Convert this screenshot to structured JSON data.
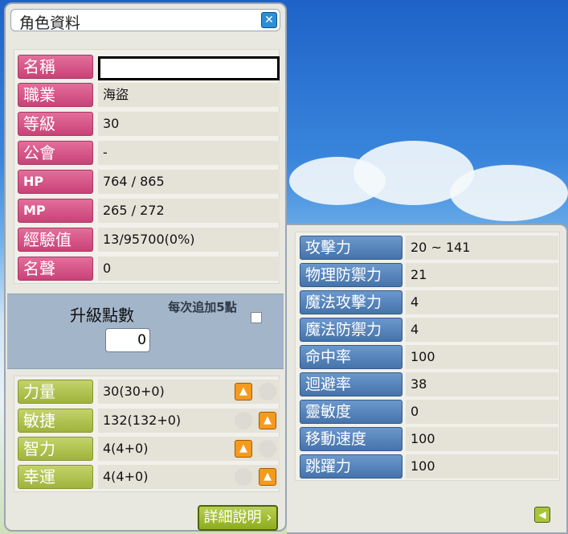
{
  "window": {
    "title": "角色資料",
    "close_icon": "close-icon"
  },
  "info": [
    {
      "label": "名稱",
      "value": ""
    },
    {
      "label": "職業",
      "value": "海盜"
    },
    {
      "label": "等級",
      "value": "30"
    },
    {
      "label": "公會",
      "value": "-"
    },
    {
      "label": "HP",
      "value": "764 / 865"
    },
    {
      "label": "MP",
      "value": "265 / 272"
    },
    {
      "label": "經驗值",
      "value": "13/95700(0%)"
    },
    {
      "label": "名聲",
      "value": "0"
    }
  ],
  "ability_points": {
    "title": "升級點數",
    "value": "0",
    "auto_add_label": "每次追加5點",
    "auto_add_checked": false
  },
  "stats": [
    {
      "label": "力量",
      "value": "30(30+0)",
      "up_enabled": true
    },
    {
      "label": "敏捷",
      "value": "132(132+0)",
      "up_enabled": true
    },
    {
      "label": "智力",
      "value": "4(4+0)",
      "up_enabled": true
    },
    {
      "label": "幸運",
      "value": "4(4+0)",
      "up_enabled": true
    }
  ],
  "detail_button": "詳細說明",
  "details": [
    {
      "label": "攻擊力",
      "value": "20 ~ 141"
    },
    {
      "label": "物理防禦力",
      "value": "21"
    },
    {
      "label": "魔法攻擊力",
      "value": "4"
    },
    {
      "label": "魔法防禦力",
      "value": "4"
    },
    {
      "label": "命中率",
      "value": "100"
    },
    {
      "label": "迴避率",
      "value": "38"
    },
    {
      "label": "靈敏度",
      "value": "0"
    },
    {
      "label": "移動速度",
      "value": "100"
    },
    {
      "label": "跳躍力",
      "value": "100"
    }
  ],
  "colors": {
    "info_label": "#c94277",
    "stat_label": "#9fb33c",
    "detail_label": "#4573ab",
    "up_button": "#f59a1d"
  }
}
